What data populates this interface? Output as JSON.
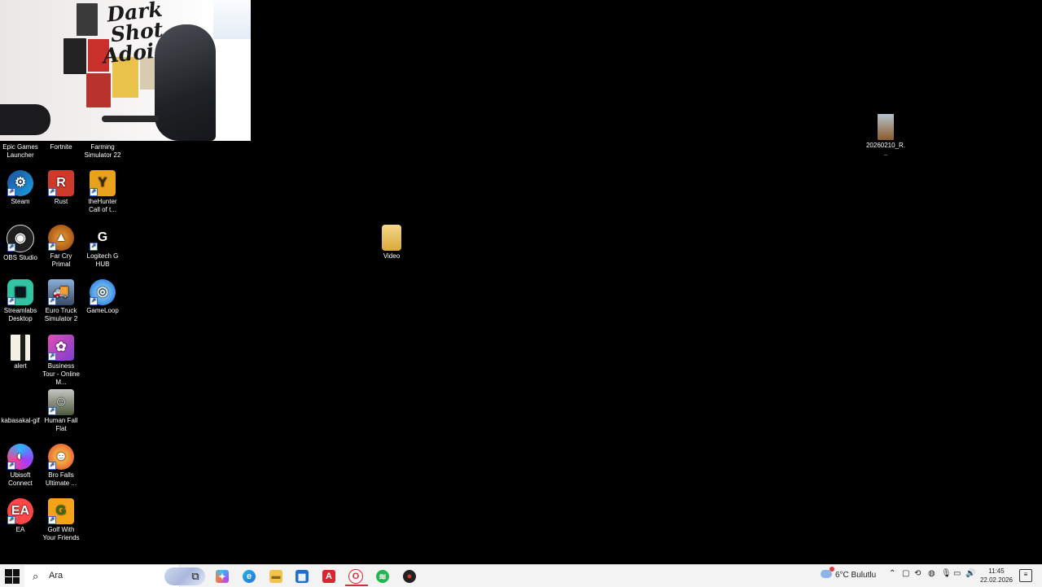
{
  "webcam": {
    "title": "Dark Shot Adoist"
  },
  "desktop_icons": [
    {
      "label": "Epic Games Launcher"
    },
    {
      "label": "Fortnite"
    },
    {
      "label": "Farming Simulator 22"
    },
    {
      "label": "Steam"
    },
    {
      "label": "Rust"
    },
    {
      "label": "theHunter Call of t..."
    },
    {
      "label": "OBS Studio"
    },
    {
      "label": "Far Cry Primal"
    },
    {
      "label": "Logitech G HUB"
    },
    {
      "label": "Streamlabs Desktop"
    },
    {
      "label": "Euro Truck Simulator 2"
    },
    {
      "label": "GameLoop"
    },
    {
      "label": "alert"
    },
    {
      "label": "Business Tour - Online M..."
    },
    {
      "label": "kabasakal-gif"
    },
    {
      "label": "Human Fall Flat"
    },
    {
      "label": "Ubisoft Connect"
    },
    {
      "label": "Bro Falls Ultimate ..."
    },
    {
      "label": "EA"
    },
    {
      "label": "Golf With Your Friends"
    },
    {
      "label": "Video"
    },
    {
      "label": "20260210_R..."
    }
  ],
  "taskbar": {
    "search_placeholder": "Ara",
    "apps": [
      {
        "name": "task-view",
        "glyph": "⧉"
      },
      {
        "name": "copilot",
        "glyph": "✦"
      },
      {
        "name": "edge",
        "glyph": "e"
      },
      {
        "name": "file-explorer",
        "glyph": "▬"
      },
      {
        "name": "store",
        "glyph": "▦"
      },
      {
        "name": "adobe",
        "glyph": "A"
      },
      {
        "name": "opera",
        "glyph": "O"
      },
      {
        "name": "spotify",
        "glyph": "≋"
      },
      {
        "name": "app-red-dot",
        "glyph": "●"
      }
    ],
    "weather": "6°C Bulutlu",
    "time": "11:45",
    "date": "22.02.2026"
  }
}
